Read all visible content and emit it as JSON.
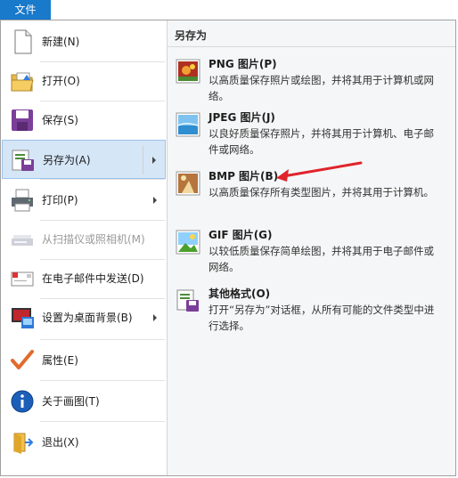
{
  "file_tab": "文件",
  "left_menu": [
    {
      "label": "新建(N)",
      "icon": "new-document-icon"
    },
    {
      "label": "打开(O)",
      "icon": "open-folder-icon"
    },
    {
      "label": "保存(S)",
      "icon": "save-floppy-icon"
    },
    {
      "label": "另存为(A)",
      "icon": "save-as-icon",
      "selected": true,
      "submenu": true
    },
    {
      "label": "打印(P)",
      "icon": "printer-icon",
      "submenu": true
    },
    {
      "label": "从扫描仪或照相机(M)",
      "icon": "scanner-icon",
      "disabled": true
    },
    {
      "label": "在电子邮件中发送(D)",
      "icon": "email-icon"
    },
    {
      "label": "设置为桌面背景(B)",
      "icon": "desktop-background-icon",
      "submenu": true
    },
    {
      "label": "属性(E)",
      "icon": "checkmark-icon"
    },
    {
      "label": "关于画图(T)",
      "icon": "info-icon"
    },
    {
      "label": "退出(X)",
      "icon": "exit-icon"
    }
  ],
  "submenu": {
    "header": "另存为",
    "options": [
      {
        "title": "PNG 图片(P)",
        "desc": "以高质量保存照片或绘图，并将其用于计算机或网络。",
        "icon": "png-image-icon"
      },
      {
        "title": "JPEG 图片(J)",
        "desc": "以良好质量保存照片，并将其用于计算机、电子邮件或网络。",
        "icon": "jpeg-image-icon"
      },
      {
        "title": "BMP 图片(B)",
        "desc": "以高质量保存所有类型图片，并将其用于计算机。",
        "icon": "bmp-image-icon"
      },
      {
        "title": "GIF 图片(G)",
        "desc": "以较低质量保存简单绘图，并将其用于电子邮件或网络。",
        "icon": "gif-image-icon"
      },
      {
        "title": "其他格式(O)",
        "desc": "打开“另存为”对话框，从所有可能的文件类型中进行选择。",
        "icon": "other-formats-icon"
      }
    ]
  },
  "colors": {
    "file_tab_bg": "#1979ca",
    "selected_bg": "#d5e6f7",
    "annotation_arrow": "#e0232b"
  }
}
